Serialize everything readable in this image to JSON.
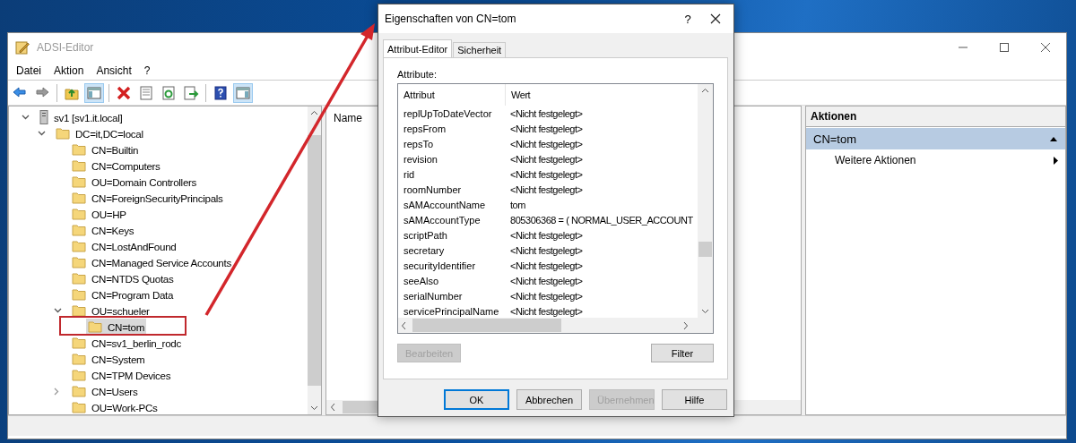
{
  "main_window": {
    "title": "ADSI-Editor",
    "menu": [
      "Datei",
      "Aktion",
      "Ansicht",
      "?"
    ],
    "toolbar": [
      [
        {
          "on": false
        },
        {
          "on": false
        }
      ],
      [
        {
          "on": false
        },
        {
          "on": true
        }
      ],
      [
        {
          "on": false
        },
        {
          "on": false
        },
        {
          "on": false
        },
        {
          "on": false
        }
      ],
      [
        {
          "on": false
        },
        {
          "on": true
        }
      ]
    ],
    "tree": [
      {
        "label": "sv1 [sv1.it.local]",
        "kind": "server",
        "expandable": true,
        "expanded": true,
        "selected": false,
        "children": [
          {
            "label": "DC=it,DC=local",
            "kind": "folder",
            "expandable": true,
            "expanded": true,
            "selected": false,
            "children": [
              {
                "label": "CN=Builtin",
                "kind": "folder",
                "expandable": false,
                "selected": false
              },
              {
                "label": "CN=Computers",
                "kind": "folder",
                "expandable": false,
                "selected": false
              },
              {
                "label": "OU=Domain Controllers",
                "kind": "folder",
                "expandable": false,
                "selected": false
              },
              {
                "label": "CN=ForeignSecurityPrincipals",
                "kind": "folder",
                "expandable": false,
                "selected": false
              },
              {
                "label": "OU=HP",
                "kind": "folder",
                "expandable": false,
                "selected": false
              },
              {
                "label": "CN=Keys",
                "kind": "folder",
                "expandable": false,
                "selected": false
              },
              {
                "label": "CN=LostAndFound",
                "kind": "folder",
                "expandable": false,
                "selected": false
              },
              {
                "label": "CN=Managed Service Accounts",
                "kind": "folder",
                "expandable": false,
                "selected": false
              },
              {
                "label": "CN=NTDS Quotas",
                "kind": "folder",
                "expandable": false,
                "selected": false
              },
              {
                "label": "CN=Program Data",
                "kind": "folder",
                "expandable": false,
                "selected": false
              },
              {
                "label": "OU=schueler",
                "kind": "folder",
                "expandable": true,
                "expanded": true,
                "selected": false,
                "children": [
                  {
                    "label": "CN=tom",
                    "kind": "folder",
                    "expandable": false,
                    "selected": true
                  }
                ]
              },
              {
                "label": "CN=sv1_berlin_rodc",
                "kind": "folder",
                "expandable": false,
                "selected": false
              },
              {
                "label": "CN=System",
                "kind": "folder",
                "expandable": false,
                "selected": false
              },
              {
                "label": "CN=TPM Devices",
                "kind": "folder",
                "expandable": false,
                "selected": false
              },
              {
                "label": "CN=Users",
                "kind": "folder",
                "expandable": true,
                "expanded": false,
                "selected": false
              },
              {
                "label": "OU=Work-PCs",
                "kind": "folder",
                "expandable": false,
                "selected": false
              }
            ]
          }
        ]
      }
    ],
    "list_columns": [
      "Name"
    ],
    "actions": {
      "title": "Aktionen",
      "section": {
        "label": "CN=tom",
        "expanded": true
      },
      "items": [
        "Weitere Aktionen"
      ]
    }
  },
  "dialog": {
    "title": "Eigenschaften von CN=tom",
    "help_button": "?",
    "tabs": [
      {
        "label": "Attribut-Editor",
        "selected": true
      },
      {
        "label": "Sicherheit",
        "selected": false
      }
    ],
    "list_label": "Attribute:",
    "columns": [
      "Attribut",
      "Wert"
    ],
    "rows": [
      {
        "attribute": "replUpToDateVector",
        "value": "<Nicht festgelegt>"
      },
      {
        "attribute": "repsFrom",
        "value": "<Nicht festgelegt>"
      },
      {
        "attribute": "repsTo",
        "value": "<Nicht festgelegt>"
      },
      {
        "attribute": "revision",
        "value": "<Nicht festgelegt>"
      },
      {
        "attribute": "rid",
        "value": "<Nicht festgelegt>"
      },
      {
        "attribute": "roomNumber",
        "value": "<Nicht festgelegt>"
      },
      {
        "attribute": "sAMAccountName",
        "value": "tom"
      },
      {
        "attribute": "sAMAccountType",
        "value": "805306368 = ( NORMAL_USER_ACCOUNT"
      },
      {
        "attribute": "scriptPath",
        "value": "<Nicht festgelegt>"
      },
      {
        "attribute": "secretary",
        "value": "<Nicht festgelegt>"
      },
      {
        "attribute": "securityIdentifier",
        "value": "<Nicht festgelegt>"
      },
      {
        "attribute": "seeAlso",
        "value": "<Nicht festgelegt>"
      },
      {
        "attribute": "serialNumber",
        "value": "<Nicht festgelegt>"
      },
      {
        "attribute": "servicePrincipalName",
        "value": "<Nicht festgelegt>"
      }
    ],
    "list_buttons": [
      {
        "label": "Bearbeiten",
        "disabled": true
      },
      {
        "label": "Filter",
        "disabled": false
      }
    ],
    "footer_buttons": [
      {
        "label": "OK",
        "default": true,
        "disabled": false
      },
      {
        "label": "Abbrechen",
        "default": false,
        "disabled": false
      },
      {
        "label": "Übernehmen",
        "default": false,
        "disabled": true
      },
      {
        "label": "Hilfe",
        "default": false,
        "disabled": false
      }
    ]
  }
}
